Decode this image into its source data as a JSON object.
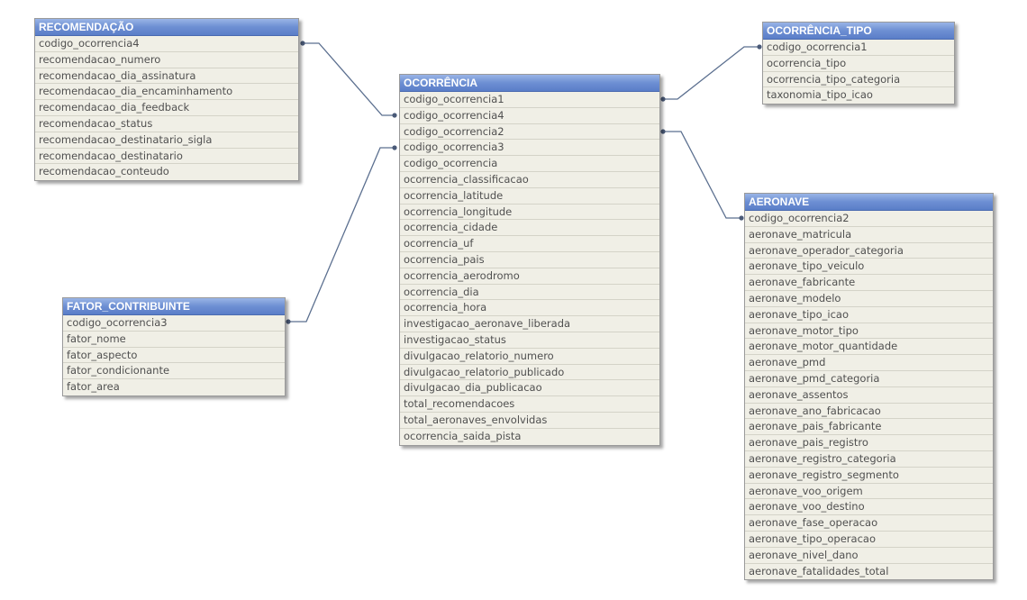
{
  "tables": {
    "recomendacao": {
      "name": "RECOMENDAÇÃO",
      "fields": [
        "codigo_ocorrencia4",
        "recomendacao_numero",
        "recomendacao_dia_assinatura",
        "recomendacao_dia_encaminhamento",
        "recomendacao_dia_feedback",
        "recomendacao_status",
        "recomendacao_destinatario_sigla",
        "recomendacao_destinatario",
        "recomendacao_conteudo"
      ]
    },
    "fator_contribuinte": {
      "name": "FATOR_CONTRIBUINTE",
      "fields": [
        "codigo_ocorrencia3",
        "fator_nome",
        "fator_aspecto",
        "fator_condicionante",
        "fator_area"
      ]
    },
    "ocorrencia": {
      "name": "OCORRÊNCIA",
      "fields": [
        "codigo_ocorrencia1",
        "codigo_ocorrencia4",
        "codigo_ocorrencia2",
        "codigo_ocorrencia3",
        "codigo_ocorrencia",
        "ocorrencia_classificacao",
        "ocorrencia_latitude",
        "ocorrencia_longitude",
        "ocorrencia_cidade",
        "ocorrencia_uf",
        "ocorrencia_pais",
        "ocorrencia_aerodromo",
        "ocorrencia_dia",
        "ocorrencia_hora",
        "investigacao_aeronave_liberada",
        "investigacao_status",
        "divulgacao_relatorio_numero",
        "divulgacao_relatorio_publicado",
        "divulgacao_dia_publicacao",
        "total_recomendacoes",
        "total_aeronaves_envolvidas",
        "ocorrencia_saida_pista"
      ]
    },
    "ocorrencia_tipo": {
      "name": "OCORRÊNCIA_TIPO",
      "fields": [
        "codigo_ocorrencia1",
        "ocorrencia_tipo",
        "ocorrencia_tipo_categoria",
        "taxonomia_tipo_icao"
      ]
    },
    "aeronave": {
      "name": "AERONAVE",
      "fields": [
        "codigo_ocorrencia2",
        "aeronave_matricula",
        "aeronave_operador_categoria",
        "aeronave_tipo_veiculo",
        "aeronave_fabricante",
        "aeronave_modelo",
        "aeronave_tipo_icao",
        "aeronave_motor_tipo",
        "aeronave_motor_quantidade",
        "aeronave_pmd",
        "aeronave_pmd_categoria",
        "aeronave_assentos",
        "aeronave_ano_fabricacao",
        "aeronave_pais_fabricante",
        "aeronave_pais_registro",
        "aeronave_registro_categoria",
        "aeronave_registro_segmento",
        "aeronave_voo_origem",
        "aeronave_voo_destino",
        "aeronave_fase_operacao",
        "aeronave_tipo_operacao",
        "aeronave_nivel_dano",
        "aeronave_fatalidades_total"
      ]
    }
  },
  "links": [
    {
      "from": "recomendacao",
      "from_field": "codigo_ocorrencia4",
      "to": "ocorrencia",
      "to_field": "codigo_ocorrencia4"
    },
    {
      "from": "fator_contribuinte",
      "from_field": "codigo_ocorrencia3",
      "to": "ocorrencia",
      "to_field": "codigo_ocorrencia3"
    },
    {
      "from": "ocorrencia",
      "from_field": "codigo_ocorrencia1",
      "to": "ocorrencia_tipo",
      "to_field": "codigo_ocorrencia1"
    },
    {
      "from": "ocorrencia",
      "from_field": "codigo_ocorrencia2",
      "to": "aeronave",
      "to_field": "codigo_ocorrencia2"
    }
  ],
  "colors": {
    "header_top": "#9ab4e6",
    "header_bottom": "#5a7ec8",
    "table_bg": "#f0efe6",
    "link_line": "#5b6f8f"
  }
}
